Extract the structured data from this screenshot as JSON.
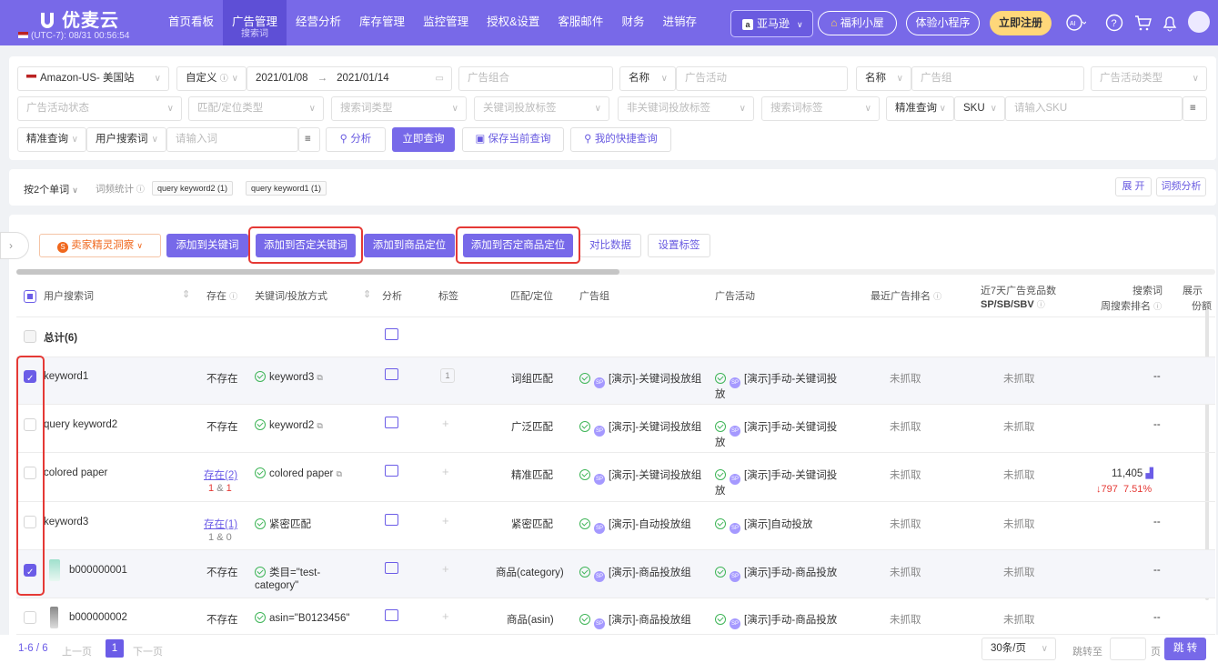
{
  "brand": {
    "name": "优麦云",
    "timezone": "(UTC-7): 08/31 00:56:54"
  },
  "nav": [
    {
      "label": "首页看板"
    },
    {
      "label": "广告管理",
      "sub": "搜索词",
      "active": true
    },
    {
      "label": "经营分析"
    },
    {
      "label": "库存管理"
    },
    {
      "label": "监控管理"
    },
    {
      "label": "授权&设置"
    },
    {
      "label": "客服邮件"
    },
    {
      "label": "财务"
    },
    {
      "label": "进销存"
    }
  ],
  "header": {
    "marketplace": "亚马逊",
    "welfare": "福利小屋",
    "mini_program": "体验小程序",
    "register": "立即注册"
  },
  "filters": {
    "store": "Amazon-US- 美国站",
    "date_mode": "自定义",
    "date_start": "2021/01/08",
    "date_end": "2021/01/14",
    "ad_group_ph": "广告组合",
    "name1": "名称",
    "campaign_ph": "广告活动",
    "name2": "名称",
    "adgroup_ph": "广告组",
    "campaign_type_ph": "广告活动类型",
    "campaign_status_ph": "广告活动状态",
    "match_type_ph": "匹配/定位类型",
    "term_type_ph": "搜索词类型",
    "kw_tag_ph": "关键词投放标签",
    "nonkw_tag_ph": "非关键词投放标签",
    "term_tag_ph": "搜索词标签",
    "exact1": "精准查询",
    "sku": "SKU",
    "sku_ph": "请输入SKU",
    "exact2": "精准查询",
    "user_term": "用户搜索词",
    "input_ph": "请输入词",
    "analyze": "分析",
    "query": "立即查询",
    "save": "保存当前查询",
    "quick": "我的快捷查询"
  },
  "wordstat": {
    "split": "按2个单词",
    "label": "词频统计",
    "tags": [
      "query keyword2 (1)",
      "query keyword1 (1)"
    ],
    "expand": "展 开",
    "analysis": "词频分析"
  },
  "actions": {
    "seller_insight": "卖家精灵洞察",
    "add_kw": "添加到关键词",
    "add_neg_kw": "添加到否定关键词",
    "add_target": "添加到商品定位",
    "add_neg_target": "添加到否定商品定位",
    "compare": "对比数据",
    "set_tag": "设置标签"
  },
  "table": {
    "headers": {
      "term": "用户搜索词",
      "exists": "存在",
      "keyword": "关键词/投放方式",
      "analysis": "分析",
      "tag": "标签",
      "match": "匹配/定位",
      "adgroup": "广告组",
      "campaign": "广告活动",
      "rank": "最近广告排名",
      "competitors_l1": "近7天广告竞品数",
      "competitors_l2": "SP/SB/SBV",
      "weekly_l1": "搜索词",
      "weekly_l2": "周搜索排名",
      "share_l1": "展示",
      "share_l2": "份额"
    },
    "total": "总计(6)",
    "rows": [
      {
        "term": "keyword1",
        "exists": "不存在",
        "keyword": "keyword3",
        "tag": "1",
        "match": "词组匹配",
        "adgroup": "[演示]-关键词投放组",
        "campaign_l1": "[演示]手动-关键词投",
        "campaign_l2": "放",
        "rank": "未抓取",
        "comp": "未抓取",
        "weekly": "--",
        "checked": true
      },
      {
        "term": "query keyword2",
        "exists": "不存在",
        "keyword": "keyword2",
        "match": "广泛匹配",
        "adgroup": "[演示]-关键词投放组",
        "campaign_l1": "[演示]手动-关键词投",
        "campaign_l2": "放",
        "rank": "未抓取",
        "comp": "未抓取",
        "weekly": "--",
        "checked": false
      },
      {
        "term": "colored paper",
        "exists": "存在(2)",
        "exists_sub_a": "1",
        "exists_sub_sep": "&",
        "exists_sub_b": "1",
        "keyword": "colored paper",
        "match": "精准匹配",
        "adgroup": "[演示]-关键词投放组",
        "campaign_l1": "[演示]手动-关键词投",
        "campaign_l2": "放",
        "rank": "未抓取",
        "comp": "未抓取",
        "weekly": "11,405",
        "weekly_delta": "↓797",
        "weekly_pct": "7.51%",
        "checked": false
      },
      {
        "term": "keyword3",
        "exists": "存在(1)",
        "exists_sub_a": "1",
        "exists_sub_sep": "&",
        "exists_sub_b": "0",
        "keyword": "紧密匹配",
        "match": "紧密匹配",
        "adgroup": "[演示]-自动投放组",
        "campaign_l1": "[演示]自动投放",
        "rank": "未抓取",
        "comp": "未抓取",
        "weekly": "--",
        "checked": false
      },
      {
        "term": "b000000001",
        "exists": "不存在",
        "keyword": "类目=\"test-",
        "keyword_l2": "category\"",
        "match": "商品(category)",
        "adgroup": "[演示]-商品投放组",
        "campaign_l1": "[演示]手动-商品投放",
        "rank": "未抓取",
        "comp": "未抓取",
        "weekly": "--",
        "checked": true
      },
      {
        "term": "b000000002",
        "exists": "不存在",
        "keyword": "asin=\"B0123456\"",
        "match": "商品(asin)",
        "adgroup": "[演示]-商品投放组",
        "campaign_l1": "[演示]手动-商品投放",
        "rank": "未抓取",
        "comp": "未抓取",
        "weekly": "--",
        "checked": false
      }
    ]
  },
  "pager": {
    "range": "1-6 / 6",
    "prev": "上一页",
    "page": "1",
    "next": "下一页",
    "size": "30条/页",
    "goto": "跳转至",
    "page_unit": "页",
    "jump": "跳 转"
  },
  "colors": {
    "brand": "#7869e8",
    "accent": "#6b5ce7",
    "highlight": "#e53935",
    "success": "#3fb558",
    "down": "#e53935"
  }
}
